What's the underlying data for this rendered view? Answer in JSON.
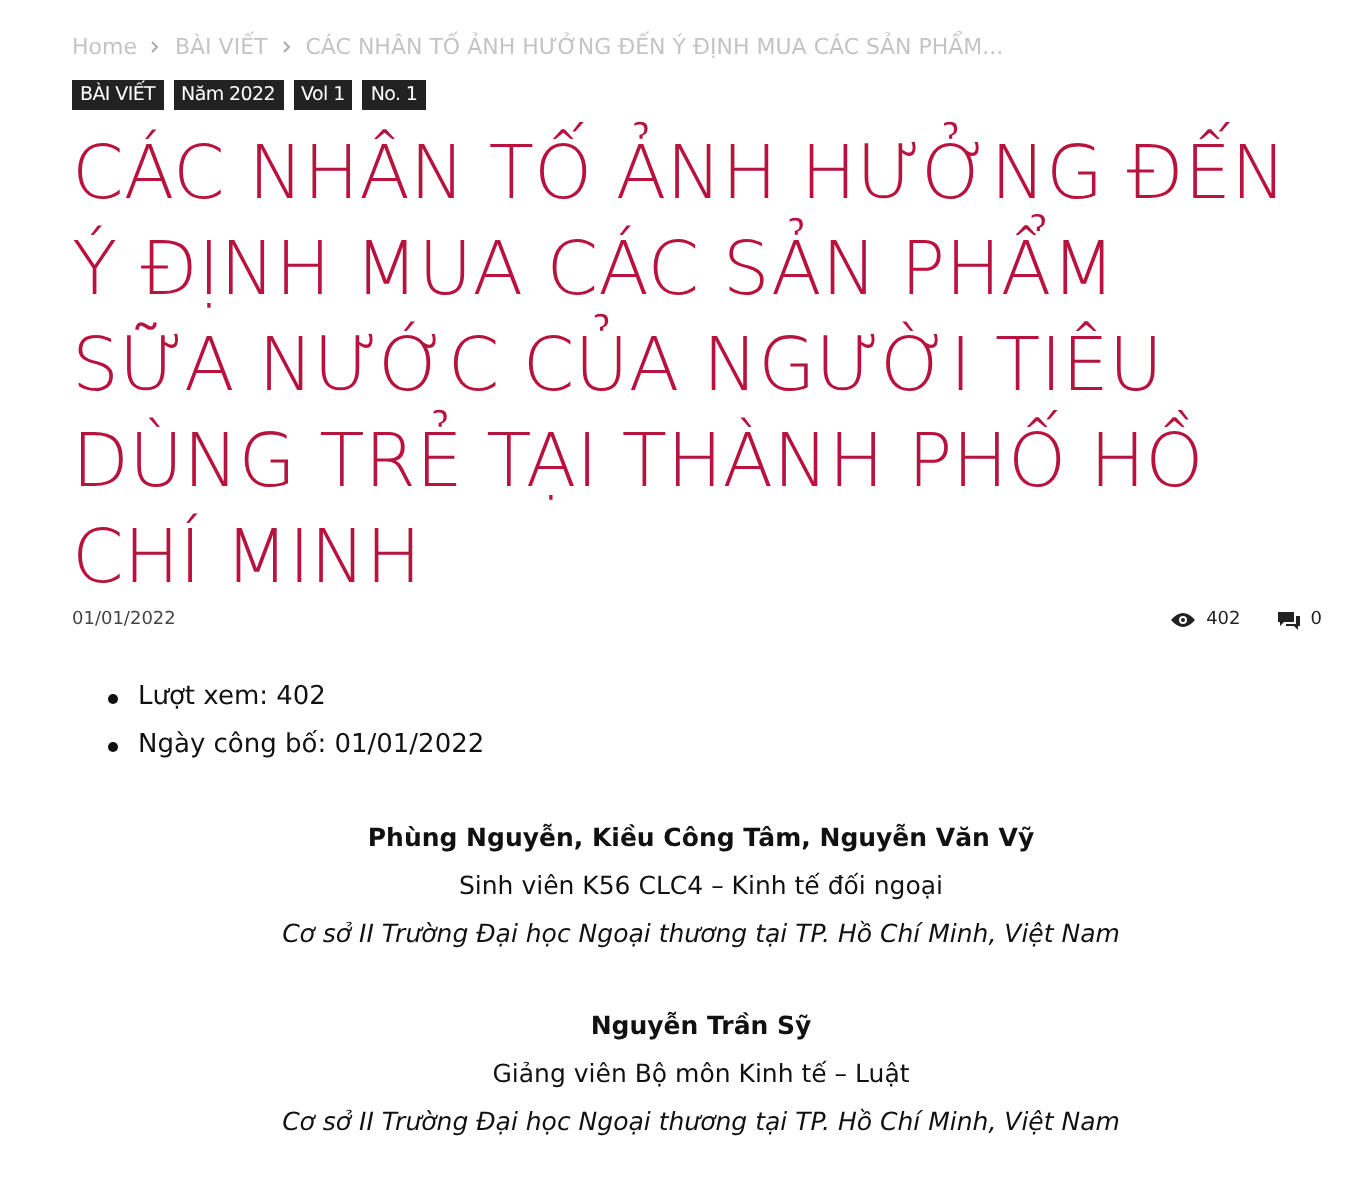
{
  "breadcrumb": [
    "Home",
    "BÀI VIẾT",
    "CÁC NHÂN TỐ ẢNH HƯỞNG ĐẾN Ý ĐỊNH MUA CÁC SẢN PHẨM..."
  ],
  "tags": [
    "BÀI VIẾT",
    "Năm 2022",
    "Vol 1",
    "No. 1"
  ],
  "title": "CÁC NHÂN TỐ ẢNH HƯỞNG ĐẾN Ý ĐỊNH MUA CÁC SẢN PHẨM SỮA NƯỚC CỦA NGƯỜI TIÊU DÙNG TRẺ TẠI THÀNH PHỐ HỒ CHÍ MINH",
  "meta": {
    "date": "01/01/2022",
    "views": "402",
    "comments": "0"
  },
  "info_list": [
    "Lượt xem: 402",
    "Ngày công bố: 01/01/2022"
  ],
  "author_groups": [
    {
      "names": "Phùng Nguyễn, Kiều Công Tâm, Nguyễn Văn Vỹ",
      "role": "Sinh viên K56 CLC4 – Kinh tế đối ngoại",
      "affiliation": "Cơ sở II Trường Đại học Ngoại thương tại TP. Hồ Chí Minh, Việt Nam"
    },
    {
      "names": "Nguyễn Trần Sỹ",
      "role": "Giảng viên Bộ môn Kinh tế – Luật",
      "affiliation": "Cơ sở II Trường Đại học Ngoại thương tại TP. Hồ Chí Minh, Việt Nam"
    }
  ]
}
